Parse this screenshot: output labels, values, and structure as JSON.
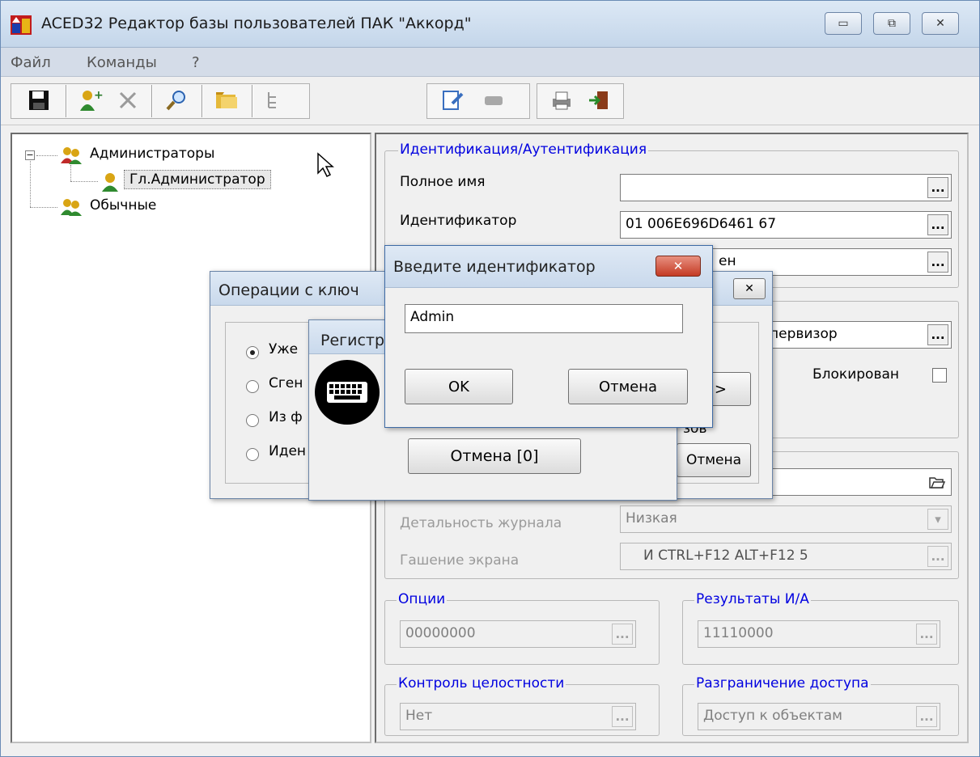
{
  "window": {
    "title": "ACED32 Редактор базы пользователей ПАК \"Аккорд\"",
    "min_glyph": "▭",
    "max_glyph": "⧉",
    "close_glyph": "✕"
  },
  "menu": {
    "file": "Файл",
    "commands": "Команды",
    "help": "?"
  },
  "tree": {
    "root": "Администраторы",
    "child": "Гл.Администратор",
    "second": "Обычные",
    "expand_glyph": "−"
  },
  "ident": {
    "legend": "Идентификация/Аутентификация",
    "fullname_label": "Полное имя",
    "fullname_value": "",
    "id_label": "Идентификатор",
    "id_value": "01 006E696D6461 67",
    "third_value": "ен"
  },
  "mid": {
    "role_value": "первизор",
    "blocked_label": "Блокирован"
  },
  "settings": {
    "detail_label": "Детальность журнала",
    "detail_value": "Низкая",
    "screen_label": "Гашение экрана",
    "screen_value": "И CTRL+F12 ALT+F12 5"
  },
  "options": {
    "legend": "Опции",
    "value": "00000000"
  },
  "results": {
    "legend": "Результаты И/А",
    "value": "11110000"
  },
  "integrity": {
    "legend": "Контроль целостности",
    "value": "Нет"
  },
  "access": {
    "legend": "Разграничение доступа",
    "value": "Доступ к объектам"
  },
  "ops_dialog": {
    "title": "Операции с ключ",
    "radio1": "Уже",
    "radio2": "Сген",
    "radio3": "Из ф",
    "radio4": "Иден",
    "next_btn": "е >",
    "cancel_btn": "Отмена",
    "close_glyph": "✕",
    "partial_text": "зов"
  },
  "reg_dialog": {
    "title": "Регистр",
    "cancel_btn": "Отмена [0]"
  },
  "id_dialog": {
    "title": "Введите идентификатор",
    "input_value": "Admin",
    "ok_btn": "OK",
    "cancel_btn": "Отмена",
    "close_glyph": "✕"
  },
  "ellipsis": "...",
  "dropdown_glyph": "▾",
  "colors": {
    "legend_blue": "#0000e0",
    "close_red": "#d04030"
  }
}
